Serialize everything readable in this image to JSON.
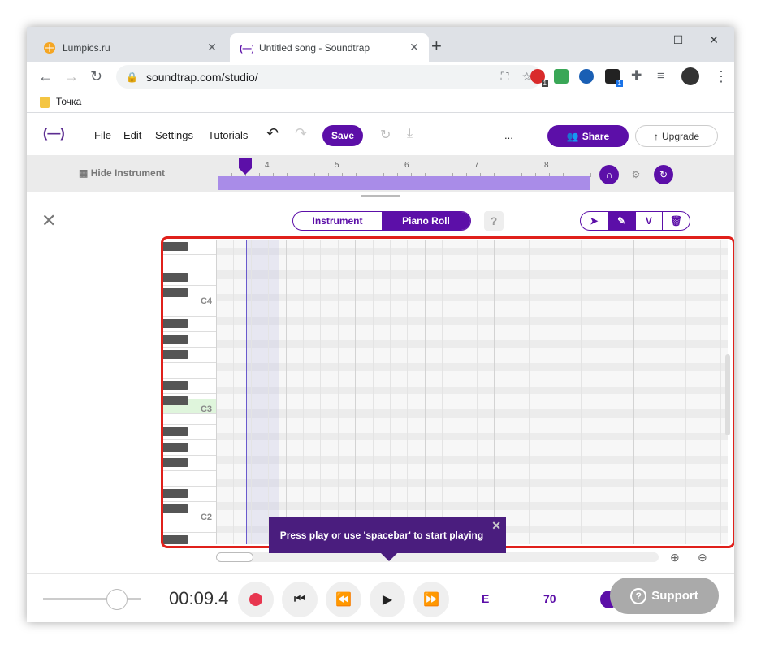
{
  "browser": {
    "tabs": [
      {
        "title": "Lumpics.ru",
        "close": "✕"
      },
      {
        "title": "Untitled song - Soundtrap",
        "close": "✕"
      }
    ],
    "new_tab": "+",
    "url": "soundtrap.com/studio/",
    "bookmark": "Точка",
    "ext_badges": [
      "1",
      "1"
    ]
  },
  "app": {
    "logo": "(—)",
    "menu": [
      "File",
      "Edit",
      "Settings",
      "Tutorials"
    ],
    "save": "Save",
    "more": "...",
    "share": "Share",
    "upgrade": "Upgrade",
    "hide_instrument": "Hide Instrument",
    "ruler": [
      "4",
      "5",
      "6",
      "7",
      "8"
    ]
  },
  "editor": {
    "tab_instrument": "Instrument",
    "tab_piano": "Piano Roll",
    "help": "?",
    "tools": [
      "",
      "",
      "V",
      ""
    ],
    "key_labels": {
      "c4": "C4",
      "c3": "C3",
      "c2": "C2"
    },
    "tooltip": "Press play or use 'spacebar' to start playing"
  },
  "transport": {
    "time": "00:09.4",
    "key": "E",
    "tempo": "70",
    "support": "Support"
  },
  "colors": {
    "accent": "#5c0fa8",
    "highlight": "#e0201b",
    "record": "#e8364f"
  }
}
